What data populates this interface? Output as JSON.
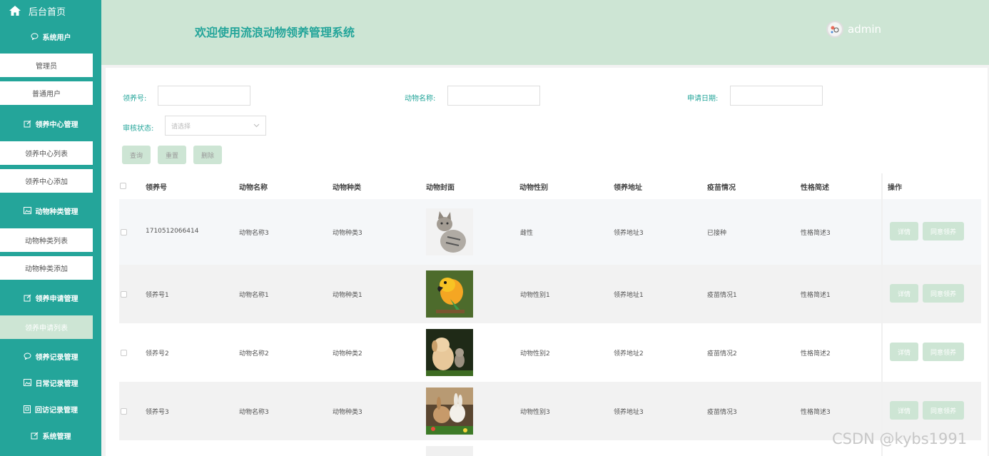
{
  "sidebar": {
    "home_label": "后台首页",
    "groups": [
      {
        "label": "系统用户"
      },
      {
        "label": "领养中心管理"
      },
      {
        "label": "动物种类管理"
      },
      {
        "label": "领养申请管理"
      },
      {
        "label": "领养记录管理"
      },
      {
        "label": "日常记录管理"
      },
      {
        "label": "回访记录管理"
      },
      {
        "label": "系统管理"
      }
    ],
    "items": [
      {
        "label": "管理员"
      },
      {
        "label": "普通用户"
      },
      {
        "label": "领养中心列表"
      },
      {
        "label": "领养中心添加"
      },
      {
        "label": "动物种类列表"
      },
      {
        "label": "动物种类添加"
      },
      {
        "label": "领养申请列表"
      }
    ],
    "accent": "#24a59a"
  },
  "header": {
    "title": "欢迎使用流浪动物领养管理系统",
    "user": "admin"
  },
  "filters": {
    "adopt_no_label": "领养号:",
    "animal_name_label": "动物名称:",
    "apply_date_label": "申请日期:",
    "status_label": "审核状态:",
    "status_placeholder": "请选择",
    "query": "查询",
    "reset": "重置",
    "delete": "删除"
  },
  "table": {
    "columns": [
      "领养号",
      "动物名称",
      "动物种类",
      "动物封面",
      "动物性别",
      "领养地址",
      "疫苗情况",
      "性格简述",
      "操作"
    ],
    "rows": [
      {
        "no": "1710512066414",
        "name": "动物名称3",
        "kind": "动物种类3",
        "cover": "cat",
        "gender": "雌性",
        "address": "领养地址3",
        "vaccine": "已接种",
        "desc": "性格简述3"
      },
      {
        "no": "领养号1",
        "name": "动物名称1",
        "kind": "动物种类1",
        "cover": "parrot",
        "gender": "动物性别1",
        "address": "领养地址1",
        "vaccine": "疫苗情况1",
        "desc": "性格简述1"
      },
      {
        "no": "领养号2",
        "name": "动物名称2",
        "kind": "动物种类2",
        "cover": "dog-cat",
        "gender": "动物性别2",
        "address": "领养地址2",
        "vaccine": "疫苗情况2",
        "desc": "性格简述2"
      },
      {
        "no": "领养号3",
        "name": "动物名称3",
        "kind": "动物种类3",
        "cover": "rabbits",
        "gender": "动物性别3",
        "address": "领养地址3",
        "vaccine": "疫苗情况3",
        "desc": "性格简述3"
      }
    ],
    "actions": {
      "detail": "详情",
      "agree": "同意领养"
    }
  },
  "watermark": "CSDN @kybs1991"
}
